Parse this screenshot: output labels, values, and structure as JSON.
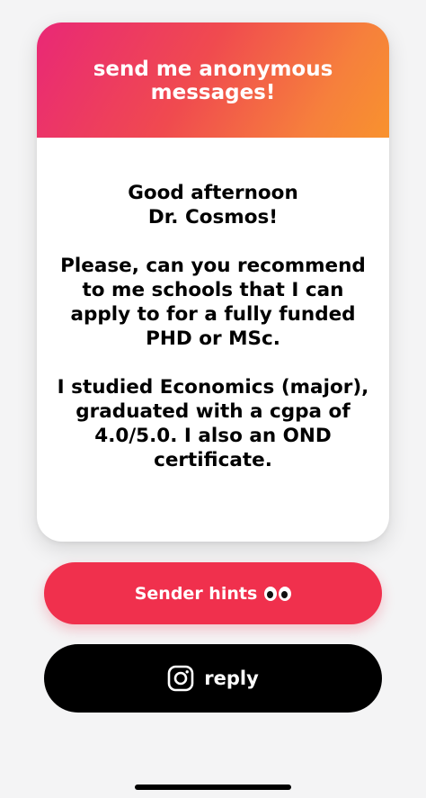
{
  "card": {
    "header_title": "send me anonymous messages!",
    "message": "Good afternoon\nDr. Cosmos!\n\nPlease, can you recommend to me schools that I can apply to for a fully funded PHD or MSc.\n\nI studied Economics (major), graduated with a cgpa of 4.0/5.0. I also an OND certificate."
  },
  "actions": {
    "hints_label": "Sender hints",
    "hints_icon": "eyes-icon",
    "reply_label": "reply",
    "reply_icon": "instagram-icon"
  },
  "colors": {
    "header_gradient_start": "#e92876",
    "header_gradient_end": "#f8922e",
    "hints_button": "#f0304d",
    "reply_button": "#000000",
    "background": "#f4f4f5"
  }
}
